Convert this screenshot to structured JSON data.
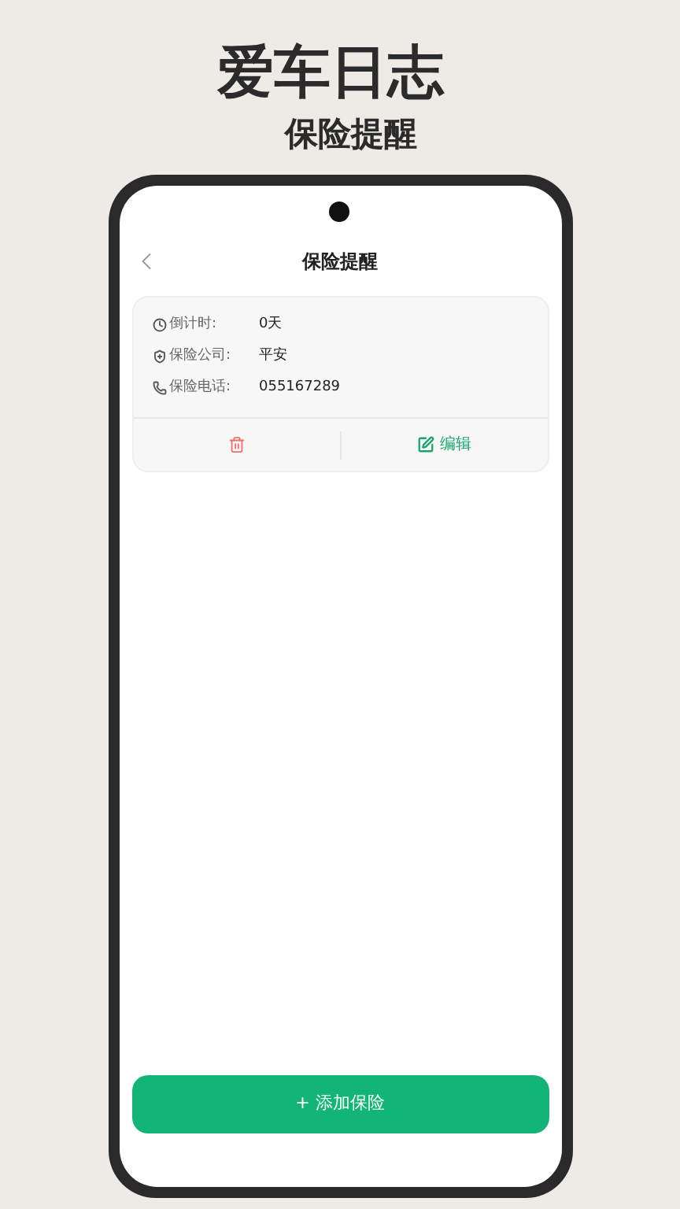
{
  "promo": {
    "title": "爱车日志",
    "subtitle": "保险提醒"
  },
  "screen": {
    "title": "保险提醒",
    "card": {
      "rows": [
        {
          "kind": "clock",
          "label": "倒计时:",
          "value": "0天"
        },
        {
          "kind": "shield",
          "label": "保险公司:",
          "value": "平安"
        },
        {
          "kind": "phone",
          "label": "保险电话:",
          "value": "055167289"
        }
      ],
      "edit_label": "编辑"
    },
    "add_button": "+ 添加保险"
  }
}
